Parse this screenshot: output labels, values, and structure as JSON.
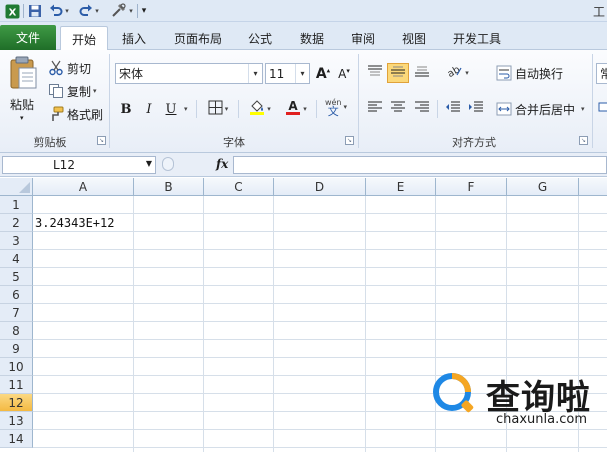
{
  "window": {
    "title_partial": "工"
  },
  "quick_access": {
    "customize_glyph": "▾"
  },
  "tabs": {
    "file": "文件",
    "items": [
      "开始",
      "插入",
      "页面布局",
      "公式",
      "数据",
      "审阅",
      "视图",
      "开发工具"
    ],
    "active": "开始"
  },
  "ribbon": {
    "clipboard": {
      "paste": "粘贴",
      "cut": "剪切",
      "copy": "复制",
      "format_painter": "格式刷",
      "label": "剪贴板"
    },
    "font": {
      "name": "宋体",
      "size": "11",
      "bold": "B",
      "italic": "I",
      "underline": "U",
      "label": "字体",
      "phonetic": "wén"
    },
    "alignment": {
      "wrap_text": "自动换行",
      "merge_center": "合并后居中",
      "label": "对齐方式"
    },
    "number": {
      "partial_combo": "常"
    }
  },
  "formula_bar": {
    "name_box": "L12",
    "fx": "fx",
    "value": ""
  },
  "grid": {
    "columns": [
      "A",
      "B",
      "C",
      "D",
      "E",
      "F",
      "G"
    ],
    "rows": [
      "1",
      "2",
      "3",
      "4",
      "5",
      "6",
      "7",
      "8",
      "9",
      "10",
      "11",
      "12",
      "13",
      "14"
    ],
    "selected_row": "12",
    "cells": {
      "A2": "3.24343E+12"
    }
  },
  "watermark": {
    "title": "查询啦",
    "url": "chaxunla.com"
  },
  "colors": {
    "file_tab": "#2e7d32",
    "selected_row_header": "#f8c956",
    "watermark_blue": "#1e88e5",
    "watermark_orange": "#f5a623"
  }
}
